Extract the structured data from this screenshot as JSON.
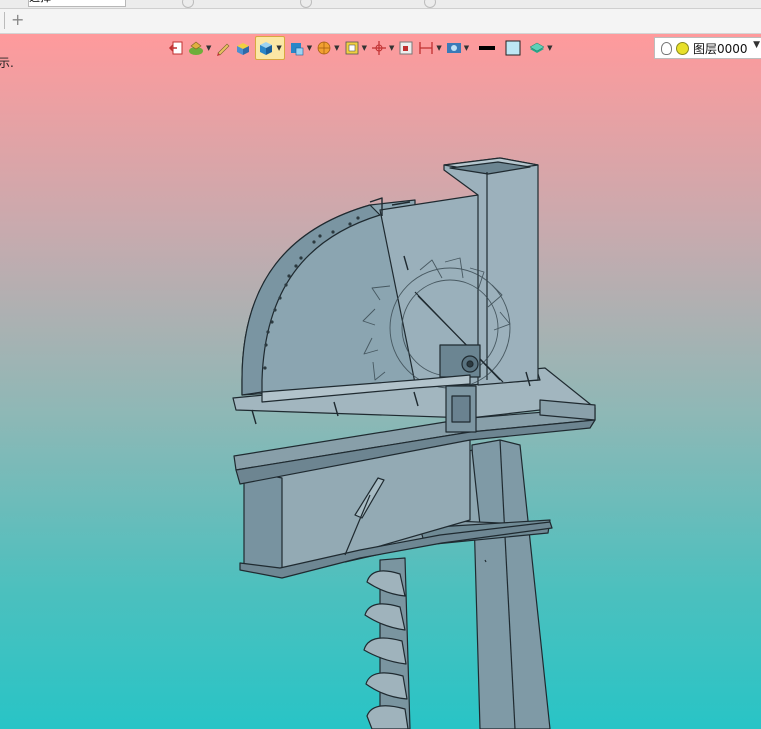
{
  "window": {
    "select_field": "选择",
    "new_tab_label": "+"
  },
  "viewport": {
    "hint_text": "示.",
    "layer_dropdown": {
      "value": "图层0000"
    },
    "background": {
      "top_color": "#ff9a9c",
      "bottom_color": "#28c4c6"
    }
  },
  "toolbar": {
    "buttons": [
      {
        "icon": "exit-view-icon",
        "active": false,
        "dropdown": false
      },
      {
        "icon": "render-mode-icon",
        "active": false,
        "dropdown": true
      },
      {
        "icon": "pencil-icon",
        "active": false,
        "dropdown": false
      },
      {
        "icon": "shaded-edges-icon",
        "active": false,
        "dropdown": false
      },
      {
        "icon": "shaded-cube-icon",
        "active": true,
        "dropdown": true
      },
      {
        "icon": "view-cube-icon",
        "active": false,
        "dropdown": true
      },
      {
        "icon": "section-icon",
        "active": false,
        "dropdown": true
      },
      {
        "icon": "zoom-fit-icon",
        "active": false,
        "dropdown": true
      },
      {
        "icon": "origin-axes-icon",
        "active": false,
        "dropdown": true
      },
      {
        "icon": "frame-icon",
        "active": false,
        "dropdown": false
      },
      {
        "icon": "dimension-icon",
        "active": false,
        "dropdown": true
      },
      {
        "icon": "display-settings-icon",
        "active": false,
        "dropdown": true
      },
      {
        "icon": "line-color-icon",
        "active": false,
        "dropdown": false
      },
      {
        "icon": "fill-color-icon",
        "active": false,
        "dropdown": false
      },
      {
        "icon": "layers-icon",
        "active": false,
        "dropdown": true
      }
    ]
  }
}
